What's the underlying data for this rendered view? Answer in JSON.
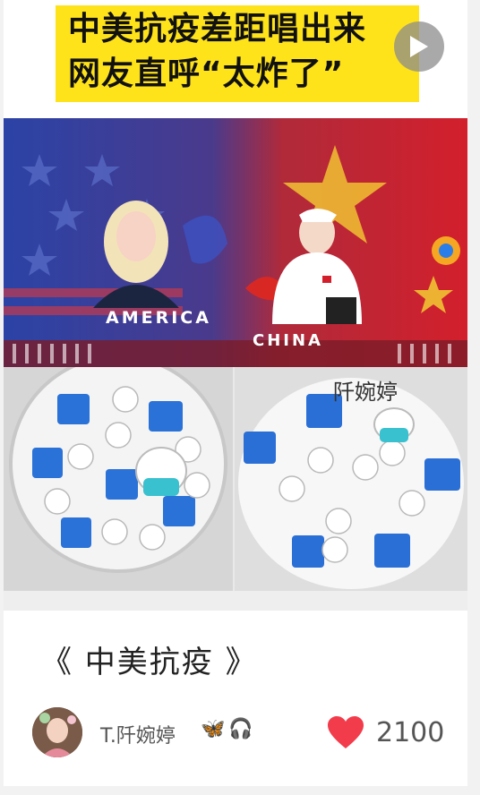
{
  "cover": {
    "headline_line1": "中美抗疫差距唱出来",
    "headline_line2": "网友直呼“太炸了”",
    "left_caption": "AMERICA",
    "right_caption": "CHINA",
    "signature": "阡婉婷"
  },
  "post": {
    "title": "《 中美抗疫 》",
    "author": "T.阡婉婷",
    "author_emojis": [
      "🦋",
      "🎧"
    ],
    "likes": "2100"
  },
  "colors": {
    "headline_bg": "#ffe31a",
    "like_heart": "#f23c4b"
  },
  "icons": {
    "play": "play-icon",
    "heart": "heart-icon"
  }
}
